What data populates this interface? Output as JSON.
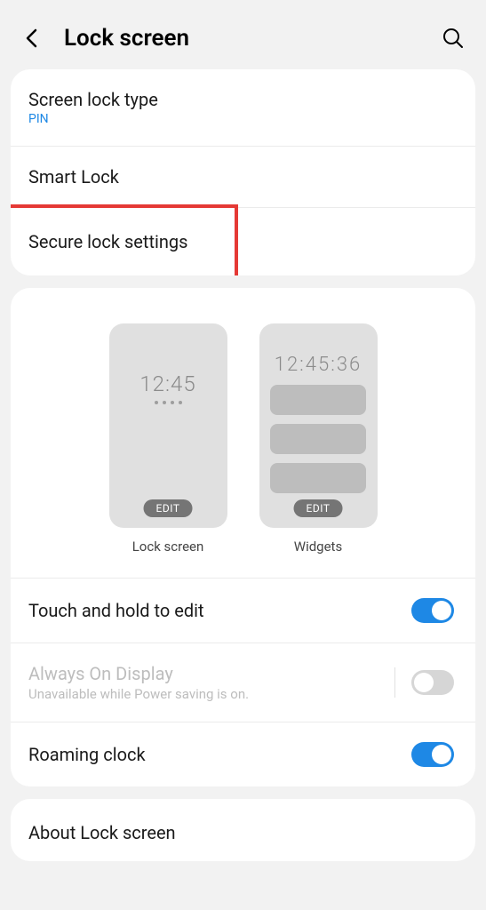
{
  "header": {
    "title": "Lock screen"
  },
  "lock_type": {
    "title": "Screen lock type",
    "value": "PIN"
  },
  "smart_lock": {
    "title": "Smart Lock"
  },
  "secure_lock": {
    "title": "Secure lock settings"
  },
  "preview": {
    "lock_screen": {
      "time": "12:45",
      "edit": "EDIT",
      "label": "Lock screen"
    },
    "widgets": {
      "time": "12:45:36",
      "edit": "EDIT",
      "label": "Widgets"
    }
  },
  "touch_hold": {
    "title": "Touch and hold to edit",
    "enabled": true
  },
  "aod": {
    "title": "Always On Display",
    "subtitle": "Unavailable while Power saving is on.",
    "enabled": false
  },
  "roaming_clock": {
    "title": "Roaming clock",
    "enabled": true
  },
  "about": {
    "title": "About Lock screen"
  }
}
